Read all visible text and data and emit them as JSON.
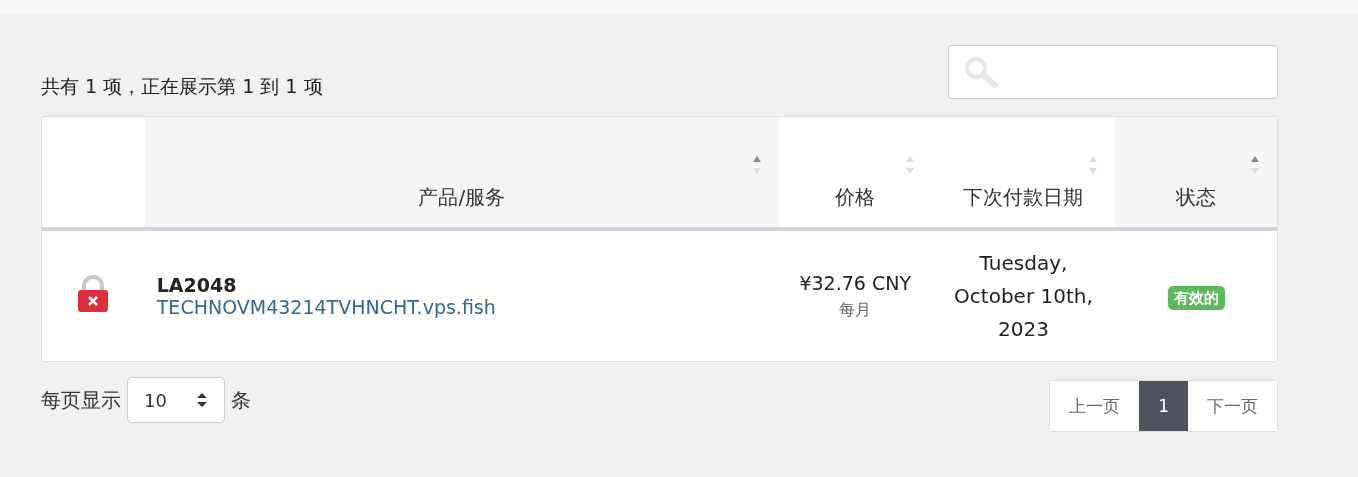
{
  "summary": "共有 1 项，正在展示第 1 到 1 项",
  "table": {
    "columns": [
      {
        "label": "产品/服务",
        "sorted": true
      },
      {
        "label": "价格",
        "sorted": false
      },
      {
        "label": "下次付款日期",
        "sorted": false
      },
      {
        "label": "状态",
        "sorted": true
      }
    ],
    "rows": [
      {
        "locked": true,
        "product": "LA2048",
        "domain": "TECHNOVM43214TVHNCHT.vps.fish",
        "price": "¥32.76 CNY",
        "cycle": "每月",
        "due_date": "Tuesday, October 10th, 2023",
        "status": "有效的"
      }
    ]
  },
  "page_size": {
    "prefix": "每页显示",
    "value": "10",
    "suffix": "条"
  },
  "pagination": [
    {
      "label": "上一页",
      "selected": false
    },
    {
      "label": "1",
      "selected": true
    },
    {
      "label": "下一页",
      "selected": false
    }
  ]
}
